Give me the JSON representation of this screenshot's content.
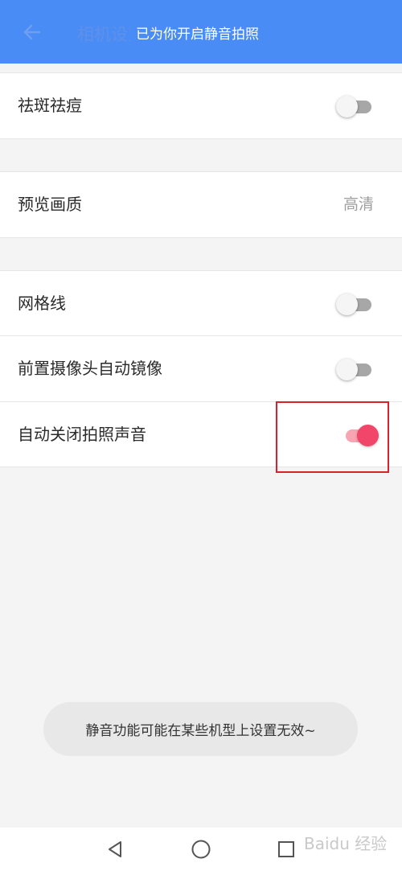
{
  "header": {
    "title": "相机设置",
    "toast": "已为你开启静音拍照"
  },
  "settings": [
    {
      "label": "祛斑祛痘",
      "control": "toggle",
      "on": false
    },
    {
      "label": "预览画质",
      "control": "value",
      "value": "高清"
    },
    {
      "label": "网格线",
      "control": "toggle",
      "on": false
    },
    {
      "label": "前置摄像头自动镜像",
      "control": "toggle",
      "on": false
    },
    {
      "label": "自动关闭拍照声音",
      "control": "toggle",
      "on": true
    }
  ],
  "bottom_toast": "静音功能可能在某些机型上设置无效~",
  "colors": {
    "header_bg": "#4a8cf5",
    "toggle_on": "#f2456a",
    "highlight": "#d8222b"
  },
  "icons": {
    "back": "arrow-left-icon",
    "nav_back": "triangle-back-icon",
    "nav_home": "circle-home-icon",
    "nav_recents": "square-recents-icon"
  },
  "watermark": "Baidu 经验"
}
